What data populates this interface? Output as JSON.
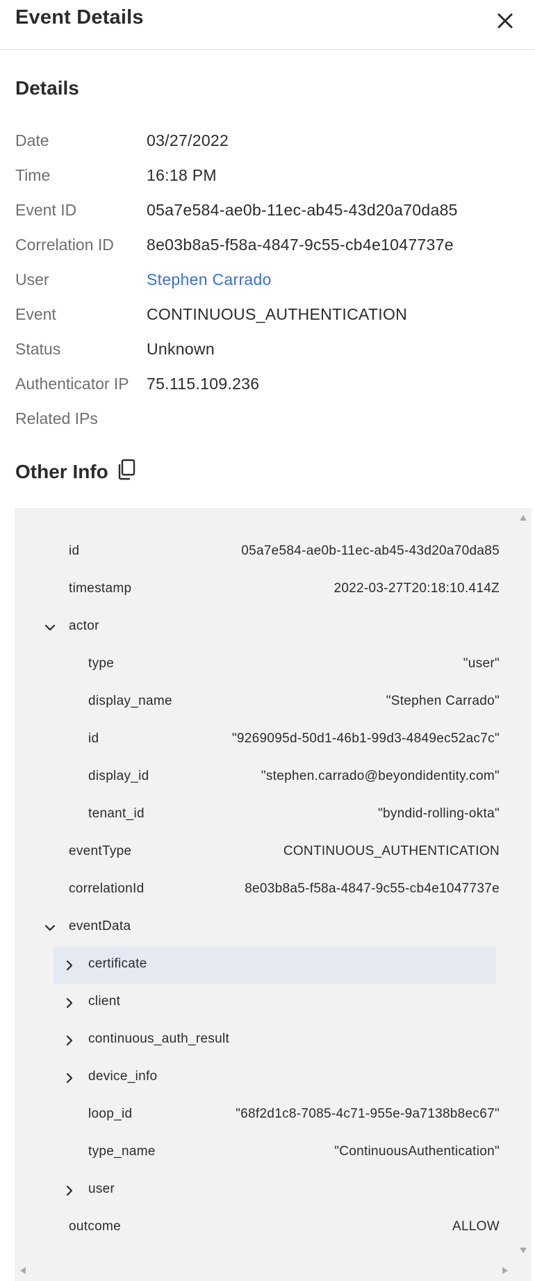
{
  "header": {
    "title": "Event Details",
    "close_icon": "close-icon"
  },
  "details": {
    "title": "Details",
    "rows": [
      {
        "label": "Date",
        "value": "03/27/2022"
      },
      {
        "label": "Time",
        "value": "16:18 PM"
      },
      {
        "label": "Event ID",
        "value": "05a7e584-ae0b-11ec-ab45-43d20a70da85"
      },
      {
        "label": "Correlation ID",
        "value": "8e03b8a5-f58a-4847-9c55-cb4e1047737e"
      },
      {
        "label": "User",
        "value": "Stephen Carrado"
      },
      {
        "label": "Event",
        "value": "CONTINUOUS_AUTHENTICATION"
      },
      {
        "label": "Status",
        "value": "Unknown"
      },
      {
        "label": "Authenticator IP",
        "value": "75.115.109.236"
      },
      {
        "label": "Related IPs",
        "value": ""
      }
    ]
  },
  "other_info": {
    "title": "Other Info",
    "copy_icon": "copy-icon",
    "tree": [
      {
        "key": "id",
        "value": "05a7e584-ae0b-11ec-ab45-43d20a70da85"
      },
      {
        "key": "timestamp",
        "value": "2022-03-27T20:18:10.414Z"
      },
      {
        "key": "actor",
        "value": "",
        "expanded": true
      },
      {
        "key": "type",
        "value": "\"user\""
      },
      {
        "key": "display_name",
        "value": "\"Stephen Carrado\""
      },
      {
        "key": "id",
        "value": "\"9269095d-50d1-46b1-99d3-4849ec52ac7c\""
      },
      {
        "key": "display_id",
        "value": "\"stephen.carrado@beyondidentity.com\""
      },
      {
        "key": "tenant_id",
        "value": "\"byndid-rolling-okta\""
      },
      {
        "key": "eventType",
        "value": "CONTINUOUS_AUTHENTICATION"
      },
      {
        "key": "correlationId",
        "value": "8e03b8a5-f58a-4847-9c55-cb4e1047737e"
      },
      {
        "key": "eventData",
        "value": "",
        "expanded": true
      },
      {
        "key": "certificate",
        "value": "",
        "expanded": false,
        "highlighted": true
      },
      {
        "key": "client",
        "value": "",
        "expanded": false
      },
      {
        "key": "continuous_auth_result",
        "value": "",
        "expanded": false
      },
      {
        "key": "device_info",
        "value": "",
        "expanded": false
      },
      {
        "key": "loop_id",
        "value": "\"68f2d1c8-7085-4c71-955e-9a7138b8ec67\""
      },
      {
        "key": "type_name",
        "value": "\"ContinuousAuthentication\""
      },
      {
        "key": "user",
        "value": "",
        "expanded": false
      },
      {
        "key": "outcome",
        "value": "ALLOW"
      }
    ]
  },
  "colors": {
    "link": "#3b6fd8",
    "label": "#6f6f6f",
    "panel_bg": "#f2f2f2",
    "highlight_bg": "#e4e9f2"
  }
}
